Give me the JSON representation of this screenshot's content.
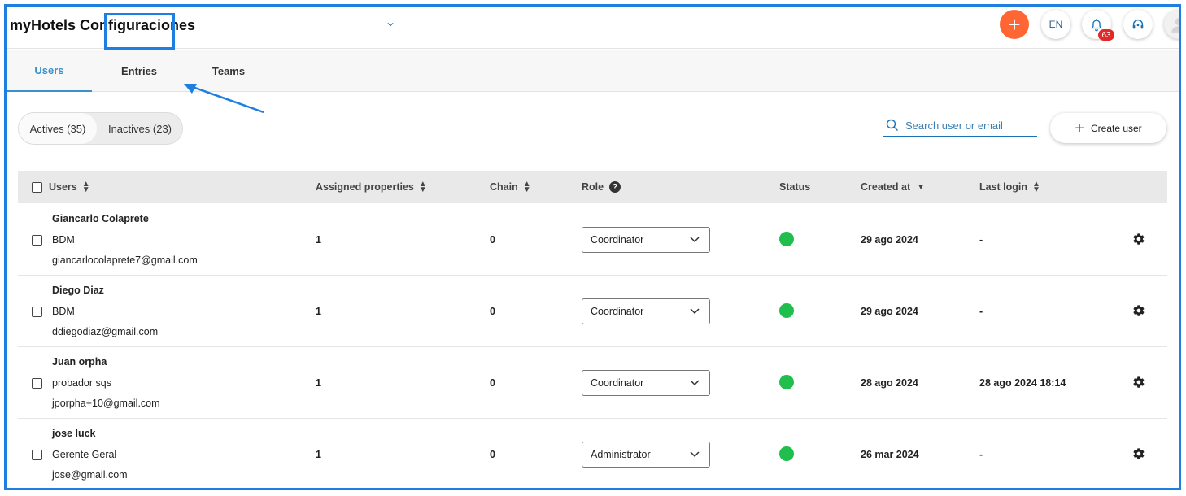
{
  "header": {
    "hotel_title": "myHotels Configuraciones",
    "add_label": "+",
    "lang_label": "EN",
    "notifications_count": "63"
  },
  "tabs": [
    {
      "label": "Users",
      "active": true
    },
    {
      "label": "Entries",
      "active": false
    },
    {
      "label": "Teams",
      "active": false
    }
  ],
  "filters": {
    "actives_label": "Actives (35)",
    "inactives_label": "Inactives (23)"
  },
  "search": {
    "placeholder": "Search user or email",
    "value": ""
  },
  "create_user_label": "Create user",
  "table": {
    "columns": {
      "users": "Users",
      "assigned_properties": "Assigned properties",
      "chain": "Chain",
      "role": "Role",
      "status": "Status",
      "created_at": "Created at",
      "last_login": "Last login"
    },
    "rows": [
      {
        "name": "Giancarlo Colaprete",
        "position": "BDM",
        "email": "giancarlocolaprete7@gmail.com",
        "assigned_properties": "1",
        "chain": "0",
        "role": "Coordinator",
        "created_at": "29 ago 2024",
        "last_login": "-"
      },
      {
        "name": "Diego Diaz",
        "position": "BDM",
        "email": "ddiegodiaz@gmail.com",
        "assigned_properties": "1",
        "chain": "0",
        "role": "Coordinator",
        "created_at": "29 ago 2024",
        "last_login": "-"
      },
      {
        "name": "Juan orpha",
        "position": "probador sqs",
        "email": "jporpha+10@gmail.com",
        "assigned_properties": "1",
        "chain": "0",
        "role": "Coordinator",
        "created_at": "28 ago 2024",
        "last_login": "28 ago 2024 18:14"
      },
      {
        "name": "jose luck",
        "position": "Gerente Geral",
        "email": "jose@gmail.com",
        "assigned_properties": "1",
        "chain": "0",
        "role": "Administrator",
        "created_at": "26 mar 2024",
        "last_login": "-"
      }
    ]
  },
  "colors": {
    "accent": "#1a73b8",
    "highlight_box": "#1e7fe0",
    "add_button": "#ff6633",
    "status_active": "#1fbe4d",
    "badge": "#e02929"
  }
}
